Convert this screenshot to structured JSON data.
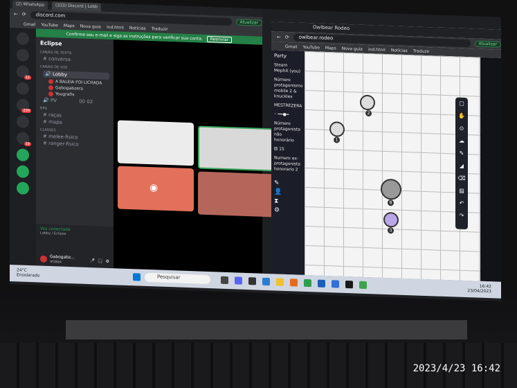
{
  "photo": {
    "timestamp": "2023/4/23 16:42"
  },
  "discord_window": {
    "tabs": [
      "(2) WhatsApp",
      "(333) Discord | Lobb"
    ],
    "url": "discord.com",
    "bookmarks": [
      "Gmail",
      "YouTube",
      "Maps",
      "Nova guia",
      "ind.html",
      "Notícias",
      "Traduzir"
    ],
    "update_button": "Atualizar",
    "banner_text": "Confirme seu e-mail e siga as instruções para verificar sua conta.",
    "banner_button": "Reenviar",
    "server_name": "Eclipse",
    "categories": {
      "text": "CANAIS DE TEXTO",
      "voice": "CANAIS DE VOZ",
      "rpg": "RPG",
      "classes": "CLASSES"
    },
    "channels": {
      "conversa": "conversa",
      "lobby": "Lobby",
      "pv": "PV",
      "racas": "raças",
      "mapa": "mapa",
      "melee": "melee-fisico",
      "ranger": "ranger-fisico"
    },
    "voice_users": [
      "A BALEIA FOI LICHADA",
      "Gabogabzera",
      "Yougrafix"
    ],
    "pv_count": "00 02",
    "voice_status": "Voz conectada",
    "voice_location": "Lobby / Eclipse",
    "username": "Gabogabz...",
    "user_tag": "#0864",
    "server_badges": [
      "12",
      "209",
      "19"
    ]
  },
  "taskbar": {
    "weather_temp": "24°C",
    "weather_desc": "Ensolarado",
    "search_placeholder": "Pesquisar",
    "time": "16:42",
    "date": "23/04/2023"
  },
  "owlbear_window": {
    "tab": "Owlbear Rodeo",
    "url": "owlbear.rodeo",
    "bookmarks": [
      "Gmail",
      "YouTube",
      "Maps",
      "Nova guia",
      "ind.html",
      "Notícias",
      "Traduzir"
    ],
    "update_button": "Atualizar",
    "party_title": "Party",
    "party_members": [
      "Steam Mephit (you)",
      "Número protagonismo mobile 2 & knuckles",
      "MESTREZERA",
      "Número protagonista não honorário",
      "Numero ex-protagonista honorario 2"
    ],
    "dice_count": "15",
    "token_numbers": [
      "1",
      "2",
      "8",
      "3"
    ]
  }
}
